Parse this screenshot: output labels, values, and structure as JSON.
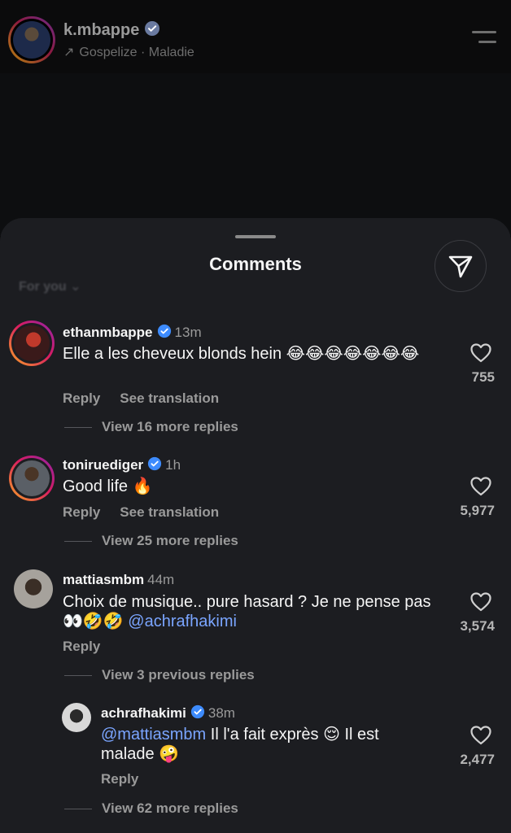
{
  "post": {
    "username": "k.mbappe",
    "subtitle": "Gospelize · Maladie"
  },
  "sheet": {
    "title": "Comments",
    "sort_label": "For you"
  },
  "comments": [
    {
      "username": "ethanmbappe",
      "time": "13m",
      "text": "Elle a les cheveux blonds hein 😂😂😂😂😂😂😂",
      "reply_label": "Reply",
      "translate_label": "See translation",
      "likes": "755",
      "view_more": "View 16 more replies"
    },
    {
      "username": "toniruediger",
      "time": "1h",
      "text": "Good life 🔥",
      "reply_label": "Reply",
      "translate_label": "See translation",
      "likes": "5,977",
      "view_more": "View 25 more replies"
    },
    {
      "username": "mattiasmbm",
      "time": "44m",
      "text_before": "Choix de musique.. pure hasard ? Je ne pense pas 👀🤣🤣 ",
      "mention": "@achrafhakimi",
      "reply_label": "Reply",
      "likes": "3,574",
      "view_more": "View 3 previous replies"
    },
    {
      "username": "achrafhakimi",
      "time": "38m",
      "mention": "@mattiasmbm",
      "text_after": " Il l'a fait exprès 😌 Il est malade 🤪",
      "reply_label": "Reply",
      "likes": "2,477",
      "view_more": "View 62 more replies"
    }
  ]
}
